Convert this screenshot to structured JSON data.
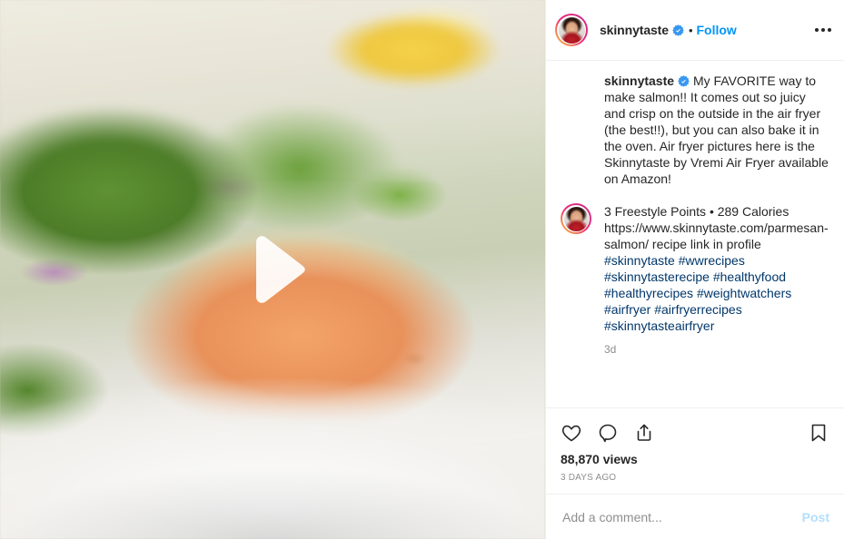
{
  "post": {
    "media": {
      "type": "video",
      "play_icon": "play-icon",
      "alt": "Air fryer parmesan crusted salmon on a white plate with arugula and red onion"
    },
    "header": {
      "avatar": "profile-avatar",
      "username": "skinnytaste",
      "verified_icon": "verified-badge-icon",
      "separator": "•",
      "follow_label": "Follow",
      "more_icon": "more-options-icon"
    },
    "caption": {
      "username": "skinnytaste",
      "verified_icon": "verified-badge-icon",
      "text": "My FAVORITE way to make salmon!! It comes out so juicy and crisp on the outside in the air fryer (the best!!), but you can also bake it in the oven. Air fryer pictures here is the Skinnytaste by Vremi Air Fryer available on Amazon!"
    },
    "comment": {
      "avatar": "commenter-avatar",
      "text": "3 Freestyle Points • 289 Calories https://www.skinnytaste.com/parmesan-salmon/ recipe link in profile",
      "hashtag_lines": [
        "#skinnytaste #wwrecipes",
        "#skinnytasterecipe #healthyfood",
        "#healthyrecipes #weightwatchers",
        "#airfryer #airfryerrecipes",
        "#skinnytasteairfryer"
      ],
      "time_ago": "3d"
    },
    "actions": {
      "like_icon": "heart-icon",
      "comment_icon": "comment-bubble-icon",
      "share_icon": "share-icon",
      "save_icon": "bookmark-icon",
      "views": "88,870 views",
      "posted_ago": "3 DAYS AGO"
    },
    "add_comment": {
      "placeholder": "Add a comment...",
      "value": "",
      "post_label": "Post"
    }
  },
  "colors": {
    "accent_link": "#0095f6",
    "hashtag": "#00376b",
    "text_primary": "#262626",
    "text_muted": "#8e8e8e",
    "divider": "#efefef",
    "post_button": "#b2dffc",
    "verified_blue": "#3897f0"
  }
}
